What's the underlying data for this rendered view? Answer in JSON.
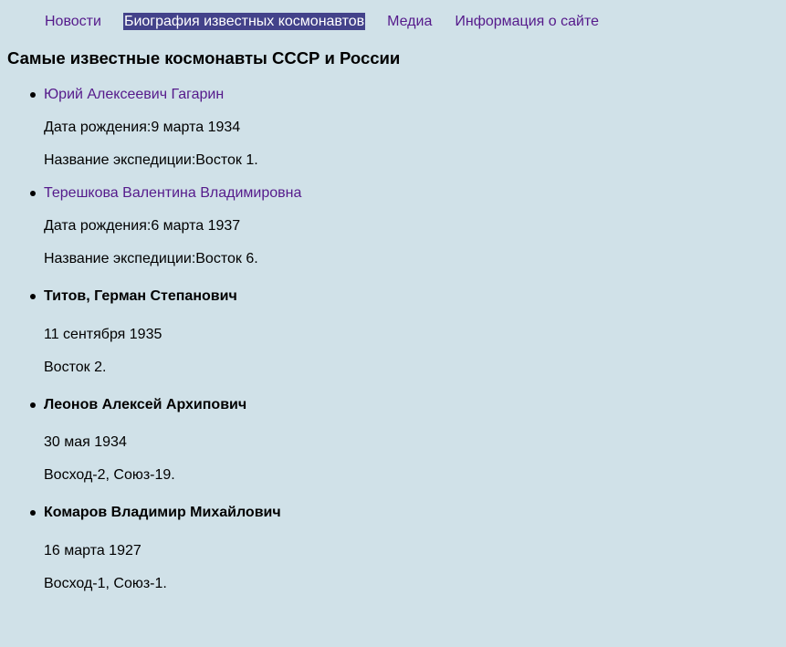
{
  "nav": {
    "items": [
      {
        "label": "Новости"
      },
      {
        "label": "Биография известных космонавтов"
      },
      {
        "label": "Медиа"
      },
      {
        "label": "Информация о сайте"
      }
    ]
  },
  "page": {
    "title": "Самые известные космонавты СССР и России"
  },
  "cosmonauts": [
    {
      "name": "Юрий Алексеевич Гагарин",
      "birth": "Дата рождения:9 марта 1934",
      "mission": "Название экспедиции:Восток 1."
    },
    {
      "name": "Терешкова Валентина Владимировна",
      "birth": "Дата рождения:6 марта 1937",
      "mission": "Название экспедиции:Восток 6."
    },
    {
      "name": "Титов, Герман Степанович",
      "birth": "11 сентября 1935",
      "mission": "Восток 2."
    },
    {
      "name": "Леонов Алексей Архипович",
      "birth": "30 мая 1934",
      "mission": "Восход-2, Союз-19."
    },
    {
      "name": "Комаров Владимир Михайлович",
      "birth": "16 марта 1927",
      "mission": "Восход-1, Союз-1."
    }
  ]
}
